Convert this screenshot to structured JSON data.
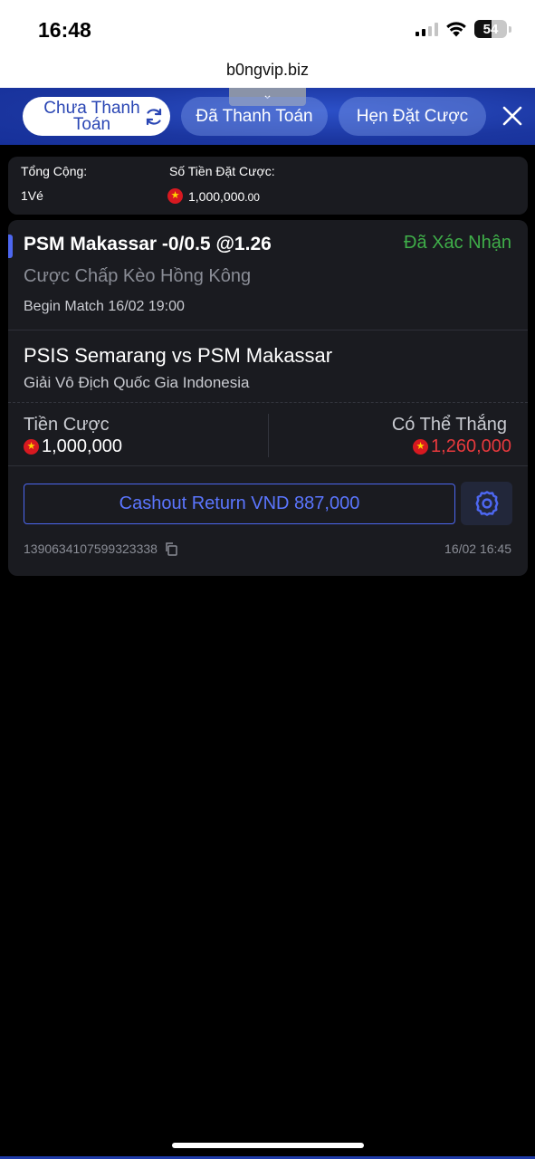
{
  "status_bar": {
    "time": "16:48",
    "battery": "54",
    "battery_level": 0.54
  },
  "browser": {
    "url": "b0ngvip.biz"
  },
  "tabs": [
    {
      "label": "Chưa Thanh Toán",
      "active": true
    },
    {
      "label": "Đã Thanh Toán",
      "active": false
    },
    {
      "label": "Hẹn Đặt Cược",
      "active": false
    }
  ],
  "summary": {
    "total_label": "Tổng Cộng:",
    "total_value": "1Vé",
    "amount_label": "Số Tiền Đặt Cược:",
    "amount_main": "1,000,000",
    "amount_decimal": ".00"
  },
  "bet": {
    "title": "PSM Makassar -0/0.5 @1.26",
    "status": "Đã Xác Nhận",
    "type": "Cược Chấp Kèo Hồng Kông",
    "begin_label": "Begin Match",
    "begin_time": "16/02 19:00",
    "match": "PSIS Semarang vs PSM Makassar",
    "league": "Giải Vô Địch Quốc Gia Indonesia",
    "stake_label": "Tiền Cược",
    "stake_value": "1,000,000",
    "win_label": "Có Thể Thắng",
    "win_value": "1,260,000",
    "cashout_label": "Cashout Return VND 887,000",
    "ticket_id": "1390634107599323338",
    "ticket_time": "16/02 16:45"
  },
  "colors": {
    "accent": "#4d67f0",
    "confirmed": "#3fae49",
    "win": "#e6393d",
    "header_blue": "#1e3aa8"
  }
}
